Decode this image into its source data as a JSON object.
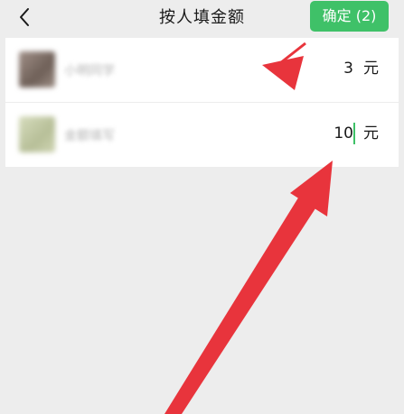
{
  "header": {
    "title": "按人填金额",
    "back_icon": "chevron-left-icon",
    "confirm_label": "确定 (2)"
  },
  "members": [
    {
      "name": "小明同学",
      "amount": "3",
      "unit": "元",
      "avatar_color": "#8a7a72"
    },
    {
      "name": "金额填写",
      "amount": "10",
      "unit": "元",
      "avatar_color": "#c8cfae"
    }
  ],
  "colors": {
    "accent": "#3fc168",
    "background": "#ededed",
    "annotation_arrow": "#e8343c"
  }
}
